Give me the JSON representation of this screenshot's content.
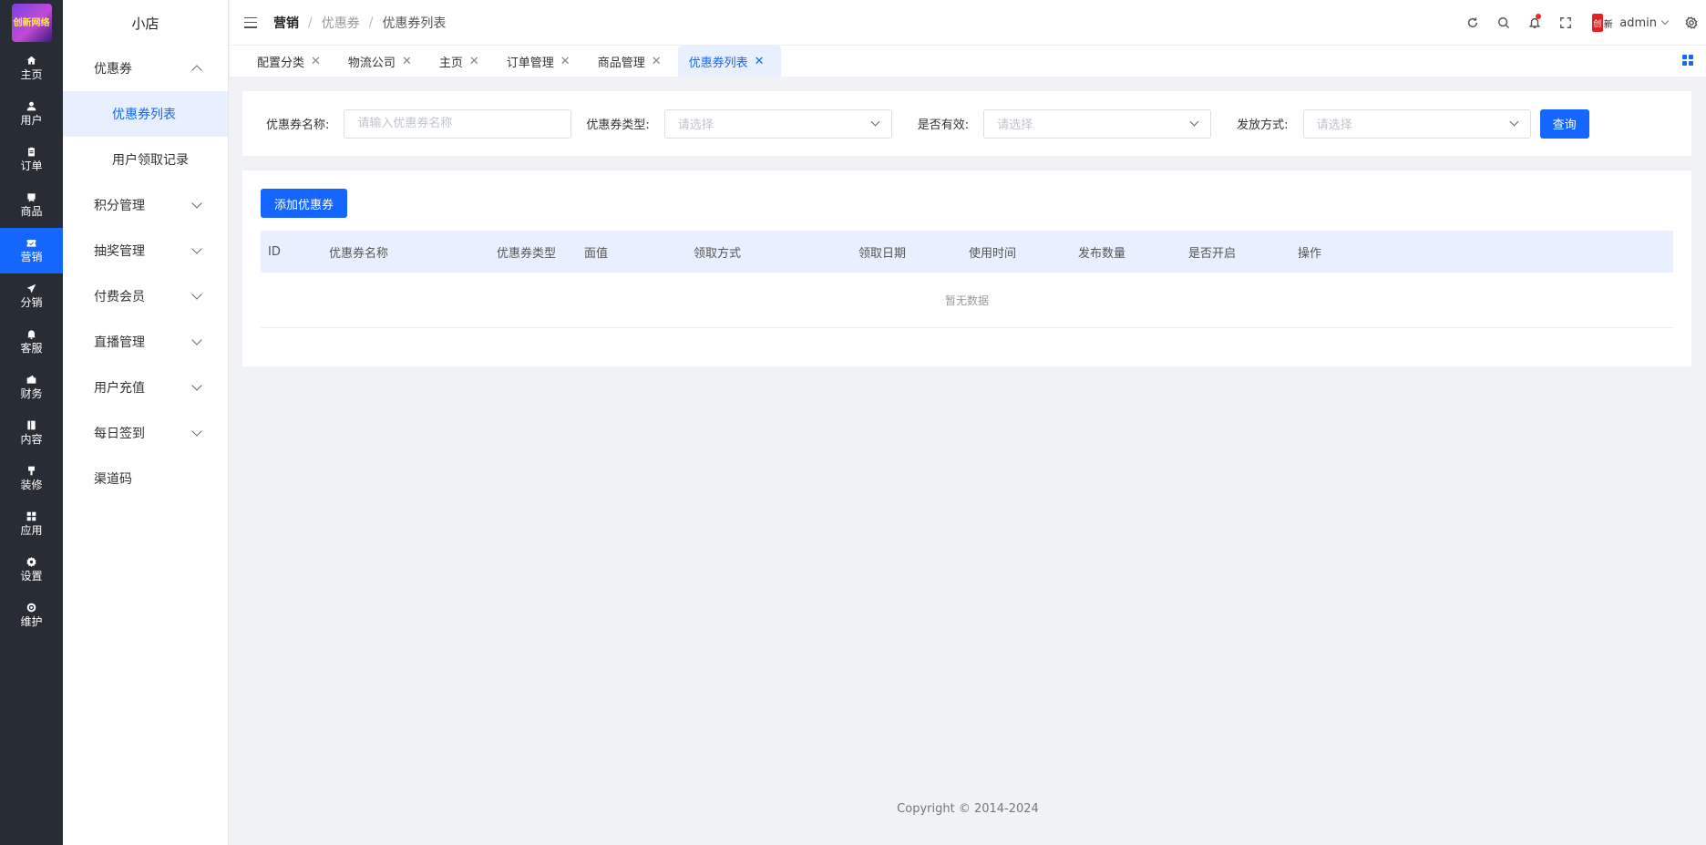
{
  "logo": {
    "text": "创新网络"
  },
  "rail": [
    {
      "label": "主页",
      "icon": "home-icon"
    },
    {
      "label": "用户",
      "icon": "user-icon"
    },
    {
      "label": "订单",
      "icon": "clipboard-icon"
    },
    {
      "label": "商品",
      "icon": "box-icon"
    },
    {
      "label": "营销",
      "icon": "ticket-icon",
      "active": true
    },
    {
      "label": "分销",
      "icon": "send-icon"
    },
    {
      "label": "客服",
      "icon": "bell-icon"
    },
    {
      "label": "财务",
      "icon": "wallet-icon"
    },
    {
      "label": "内容",
      "icon": "book-icon"
    },
    {
      "label": "装修",
      "icon": "brush-icon"
    },
    {
      "label": "应用",
      "icon": "grid-icon"
    },
    {
      "label": "设置",
      "icon": "gear-icon"
    },
    {
      "label": "维护",
      "icon": "circle-gear-icon"
    }
  ],
  "submenu": {
    "shop_name": "小店",
    "group_coupon": "优惠券",
    "coupon_list": "优惠券列表",
    "receive_records": "用户领取记录",
    "groups": [
      "积分管理",
      "抽奖管理",
      "付费会员",
      "直播管理",
      "用户充值",
      "每日签到"
    ],
    "channel_code": "渠道码"
  },
  "header": {
    "breadcrumb": [
      "营销",
      "优惠券",
      "优惠券列表"
    ],
    "separator": "/",
    "username": "admin",
    "avatar_text_a": "创",
    "avatar_text_b": "新"
  },
  "tabs": [
    {
      "label": "配置分类",
      "close": "✕"
    },
    {
      "label": "物流公司",
      "close": "✕"
    },
    {
      "label": "主页",
      "close": "✕"
    },
    {
      "label": "订单管理",
      "close": "✕"
    },
    {
      "label": "商品管理",
      "close": "✕"
    },
    {
      "label": "优惠券列表",
      "close": "✕",
      "active": true
    }
  ],
  "filter": {
    "name_label": "优惠券名称:",
    "name_placeholder": "请输入优惠券名称",
    "type_label": "优惠券类型:",
    "type_value": "请选择",
    "valid_label": "是否有效:",
    "valid_value": "请选择",
    "issue_label": "发放方式:",
    "issue_value": "请选择",
    "query_button": "查询"
  },
  "table": {
    "add_button": "添加优惠券",
    "columns": [
      "ID",
      "优惠券名称",
      "优惠券类型",
      "面值",
      "领取方式",
      "领取日期",
      "使用时间",
      "发布数量",
      "是否开启",
      "操作"
    ],
    "empty_text": "暂无数据"
  },
  "footer": {
    "copyright": "Copyright © 2014-2024"
  },
  "colors": {
    "primary": "#1565ff",
    "rail_bg": "#282c34",
    "active_bg": "#e8f0ff"
  }
}
